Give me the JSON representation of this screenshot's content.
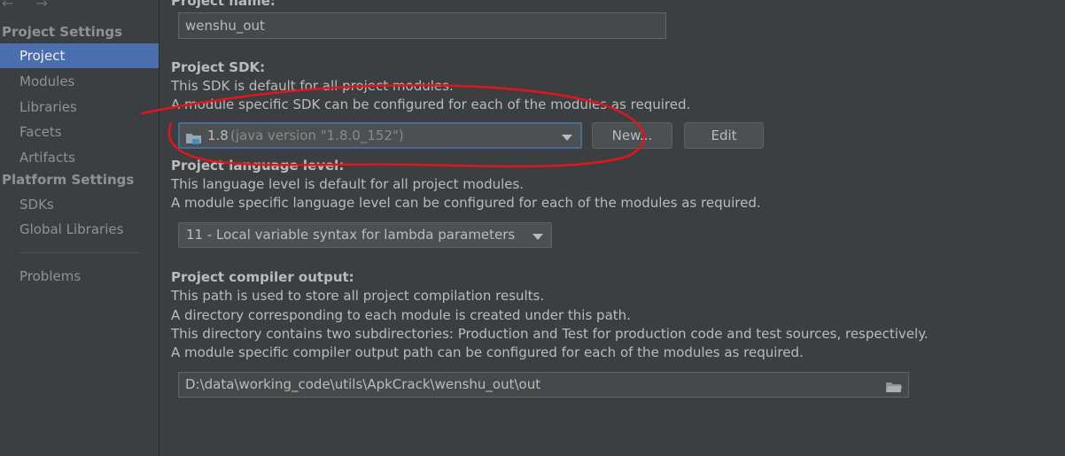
{
  "sidebar": {
    "nav_arrows": "← →",
    "project_settings_header": "Project Settings",
    "platform_settings_header": "Platform Settings",
    "items": [
      {
        "label": "Project"
      },
      {
        "label": "Modules"
      },
      {
        "label": "Libraries"
      },
      {
        "label": "Facets"
      },
      {
        "label": "Artifacts"
      },
      {
        "label": "SDKs"
      },
      {
        "label": "Global Libraries"
      },
      {
        "label": "Problems"
      }
    ]
  },
  "project_name": {
    "label": "Project name:",
    "value": "wenshu_out"
  },
  "sdk": {
    "label": "Project SDK:",
    "desc1": "This SDK is default for all project modules.",
    "desc2": "A module specific SDK can be configured for each of the modules as required.",
    "selected_version": "1.8",
    "selected_detail": "(java version \"1.8.0_152\")",
    "new_button": "New...",
    "edit_button": "Edit"
  },
  "language_level": {
    "label": "Project language level:",
    "desc1": "This language level is default for all project modules.",
    "desc2": "A module specific language level can be configured for each of the modules as required.",
    "selected": "11 - Local variable syntax for lambda parameters"
  },
  "compiler_output": {
    "label": "Project compiler output:",
    "desc1": "This path is used to store all project compilation results.",
    "desc2": "A directory corresponding to each module is created under this path.",
    "desc3": "This directory contains two subdirectories: Production and Test for production code and test sources, respectively.",
    "desc4": "A module specific compiler output path can be configured for each of the modules as required.",
    "path": "D:\\data\\working_code\\utils\\ApkCrack\\wenshu_out\\out"
  },
  "colors": {
    "selection": "#4b6eaf",
    "annotation": "#e0161d"
  }
}
